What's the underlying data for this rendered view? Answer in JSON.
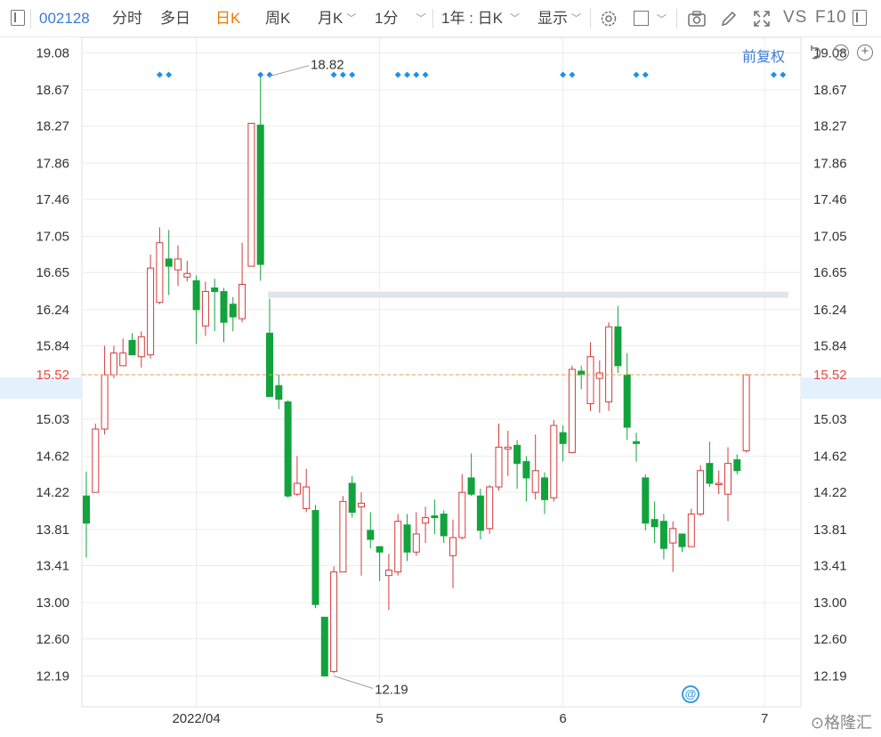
{
  "toolbar": {
    "code": "002128",
    "tabs": [
      "分时",
      "多日",
      "日K",
      "周K"
    ],
    "active_tab": "日K",
    "month": "月K",
    "minute": "1分",
    "range": "1年 : 日K",
    "display": "显示",
    "vs": "VS",
    "f10": "F10"
  },
  "subbar": {
    "adjust": "前复权"
  },
  "colors": {
    "up": "#d33b3b",
    "down": "#12a33c",
    "grid": "#ececec",
    "current_line": "#f09a4a",
    "current_bg": "#e3f1ff",
    "marker": "#1e90e8"
  },
  "chart_data": {
    "type": "candlestick",
    "y_ticks": [
      "19.08",
      "18.67",
      "18.27",
      "17.86",
      "17.46",
      "17.05",
      "16.65",
      "16.24",
      "15.84",
      "15.52",
      "15.03",
      "14.62",
      "14.22",
      "13.81",
      "13.41",
      "13.00",
      "12.60",
      "12.19"
    ],
    "ylim": [
      11.85,
      19.25
    ],
    "x_labels": [
      {
        "label": "2022/04",
        "index": 12
      },
      {
        "label": "5",
        "index": 32
      },
      {
        "label": "6",
        "index": 52
      },
      {
        "label": "7",
        "index": 74
      }
    ],
    "current_price": "15.52",
    "max_annotation": {
      "label": "18.82",
      "index": 20,
      "value": 18.82
    },
    "min_annotation": {
      "label": "12.19",
      "index": 27,
      "value": 12.19
    },
    "resistance": {
      "from_index": 20,
      "to_index": 76,
      "value": 16.4
    },
    "markers": [
      8,
      9,
      19,
      20,
      27,
      28,
      29,
      34,
      35,
      36,
      37,
      52,
      53,
      60,
      61,
      75,
      76
    ],
    "candles": [
      [
        14.18,
        13.88,
        14.45,
        13.5
      ],
      [
        14.22,
        14.92,
        14.98,
        14.22
      ],
      [
        14.92,
        15.52,
        15.84,
        14.86
      ],
      [
        15.52,
        15.76,
        15.84,
        15.48
      ],
      [
        15.62,
        15.76,
        15.92,
        15.62
      ],
      [
        15.9,
        15.74,
        15.98,
        15.74
      ],
      [
        15.72,
        15.94,
        16.0,
        15.6
      ],
      [
        15.74,
        16.7,
        16.85,
        15.7
      ],
      [
        16.32,
        16.98,
        17.15,
        16.3
      ],
      [
        16.8,
        16.72,
        17.12,
        16.4
      ],
      [
        16.68,
        16.8,
        16.95,
        16.5
      ],
      [
        16.6,
        16.64,
        16.78,
        16.55
      ],
      [
        16.56,
        16.24,
        16.62,
        15.86
      ],
      [
        16.06,
        16.44,
        16.55,
        15.95
      ],
      [
        16.48,
        16.44,
        16.58,
        16.0
      ],
      [
        16.44,
        16.1,
        16.48,
        15.88
      ],
      [
        16.3,
        16.16,
        16.38,
        16.0
      ],
      [
        16.14,
        16.52,
        16.98,
        16.1
      ],
      [
        16.72,
        18.3,
        18.3,
        16.72
      ],
      [
        18.28,
        16.74,
        18.82,
        16.56
      ],
      [
        15.98,
        15.28,
        16.36,
        15.28
      ],
      [
        15.4,
        15.25,
        15.52,
        15.14
      ],
      [
        15.22,
        14.18,
        15.24,
        14.16
      ],
      [
        14.2,
        14.32,
        14.62,
        14.18
      ],
      [
        14.04,
        14.28,
        14.48,
        14.0
      ],
      [
        14.02,
        12.98,
        14.08,
        12.94
      ],
      [
        12.84,
        12.19,
        12.84,
        12.19
      ],
      [
        12.24,
        13.34,
        13.4,
        12.22
      ],
      [
        13.34,
        14.12,
        14.18,
        13.34
      ],
      [
        14.32,
        14.0,
        14.4,
        13.94
      ],
      [
        14.06,
        14.1,
        14.22,
        13.3
      ],
      [
        13.8,
        13.7,
        14.0,
        13.6
      ],
      [
        13.62,
        13.56,
        13.62,
        13.24
      ],
      [
        13.3,
        13.36,
        13.54,
        12.92
      ],
      [
        13.34,
        13.9,
        13.98,
        13.3
      ],
      [
        13.86,
        13.56,
        13.98,
        13.46
      ],
      [
        13.56,
        13.76,
        14.0,
        13.52
      ],
      [
        13.88,
        13.94,
        14.06,
        13.66
      ],
      [
        13.96,
        13.94,
        14.14,
        13.76
      ],
      [
        13.98,
        13.74,
        14.02,
        13.66
      ],
      [
        13.52,
        13.72,
        13.92,
        13.16
      ],
      [
        13.72,
        14.22,
        14.42,
        13.7
      ],
      [
        14.38,
        14.2,
        14.65,
        14.18
      ],
      [
        14.18,
        13.8,
        14.26,
        13.7
      ],
      [
        13.82,
        14.28,
        14.3,
        13.76
      ],
      [
        14.28,
        14.72,
        14.98,
        14.24
      ],
      [
        14.7,
        14.72,
        14.9,
        14.4
      ],
      [
        14.74,
        14.54,
        14.8,
        14.26
      ],
      [
        14.56,
        14.38,
        14.62,
        14.12
      ],
      [
        14.22,
        14.46,
        14.86,
        14.14
      ],
      [
        14.38,
        14.14,
        14.44,
        13.98
      ],
      [
        14.16,
        14.96,
        15.02,
        14.12
      ],
      [
        14.88,
        14.76,
        14.96,
        14.56
      ],
      [
        14.66,
        15.58,
        15.62,
        14.66
      ],
      [
        15.56,
        15.52,
        15.62,
        15.36
      ],
      [
        15.2,
        15.72,
        15.88,
        15.12
      ],
      [
        15.48,
        15.54,
        15.68,
        15.1
      ],
      [
        15.22,
        16.05,
        16.1,
        15.12
      ],
      [
        16.05,
        15.62,
        16.28,
        15.54
      ],
      [
        15.52,
        14.94,
        15.76,
        14.8
      ],
      [
        14.78,
        14.76,
        14.88,
        14.56
      ],
      [
        14.38,
        13.88,
        14.42,
        13.8
      ],
      [
        13.92,
        13.84,
        14.12,
        13.66
      ],
      [
        13.9,
        13.6,
        13.98,
        13.48
      ],
      [
        13.66,
        13.82,
        13.9,
        13.34
      ],
      [
        13.76,
        13.62,
        13.76,
        13.56
      ],
      [
        13.62,
        13.98,
        14.04,
        13.62
      ],
      [
        13.98,
        14.46,
        14.52,
        13.96
      ],
      [
        14.54,
        14.32,
        14.78,
        14.28
      ],
      [
        14.32,
        14.32,
        14.46,
        14.2
      ],
      [
        14.2,
        14.54,
        14.72,
        13.9
      ],
      [
        14.58,
        14.46,
        14.64,
        14.42
      ],
      [
        14.68,
        15.52,
        15.52,
        14.66
      ]
    ]
  }
}
